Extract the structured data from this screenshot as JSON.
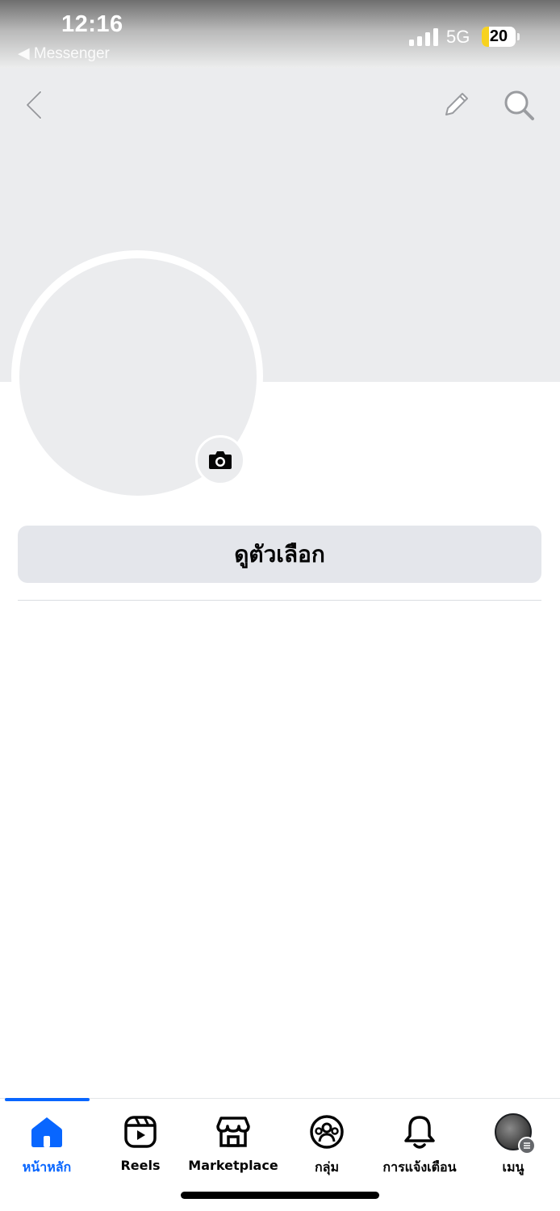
{
  "status_bar": {
    "time": "12:16",
    "back_app": "◀ Messenger",
    "network": "5G",
    "battery": "20",
    "icons": [
      "signal-icon",
      "battery-icon"
    ]
  },
  "profile": {
    "options_button": "ดูตัวเลือก",
    "icons": [
      "back-icon",
      "edit-icon",
      "search-icon",
      "camera-icon"
    ]
  },
  "bottom_nav": {
    "items": [
      {
        "label": "หน้าหลัก",
        "icon": "home-icon",
        "active": true
      },
      {
        "label": "Reels",
        "icon": "reels-icon",
        "active": false
      },
      {
        "label": "Marketplace",
        "icon": "marketplace-icon",
        "active": false
      },
      {
        "label": "กลุ่ม",
        "icon": "groups-icon",
        "active": false
      },
      {
        "label": "การแจ้งเตือน",
        "icon": "bell-icon",
        "active": false
      },
      {
        "label": "เมนู",
        "icon": "menu-avatar",
        "active": false
      }
    ]
  },
  "colors": {
    "accent": "#0866ff",
    "cover": "#ebecee",
    "button": "#e4e6eb"
  }
}
